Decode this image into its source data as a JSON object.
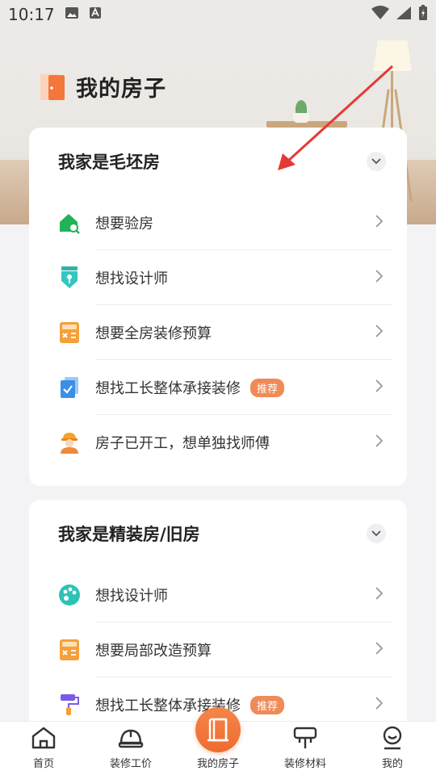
{
  "status_bar": {
    "time": "10:17"
  },
  "page": {
    "title": "我的房子"
  },
  "sections": [
    {
      "title": "我家是毛坯房",
      "items": [
        {
          "label": "想要验房",
          "icon": "house-inspect-icon"
        },
        {
          "label": "想找设计师",
          "icon": "designer-pen-icon"
        },
        {
          "label": "想要全房装修预算",
          "icon": "calculator-icon"
        },
        {
          "label": "想找工长整体承接装修",
          "icon": "document-check-icon",
          "badge": "推荐"
        },
        {
          "label": "房子已开工，想单独找师傅",
          "icon": "worker-icon"
        }
      ]
    },
    {
      "title": "我家是精装房/旧房",
      "items": [
        {
          "label": "想找设计师",
          "icon": "palette-icon"
        },
        {
          "label": "想要局部改造预算",
          "icon": "calculator-icon"
        },
        {
          "label": "想找工长整体承接装修",
          "icon": "paint-roller-icon",
          "badge": "推荐"
        }
      ]
    }
  ],
  "bottom_nav": [
    {
      "label": "首页",
      "icon": "home-icon"
    },
    {
      "label": "装修工价",
      "icon": "helmet-icon"
    },
    {
      "label": "我的房子",
      "icon": "door-icon",
      "active": true
    },
    {
      "label": "装修材料",
      "icon": "paint-tool-icon"
    },
    {
      "label": "我的",
      "icon": "profile-icon"
    }
  ],
  "colors": {
    "accent": "#ee6b30",
    "badge": "#f08a57",
    "annotation_arrow": "#e53935"
  }
}
